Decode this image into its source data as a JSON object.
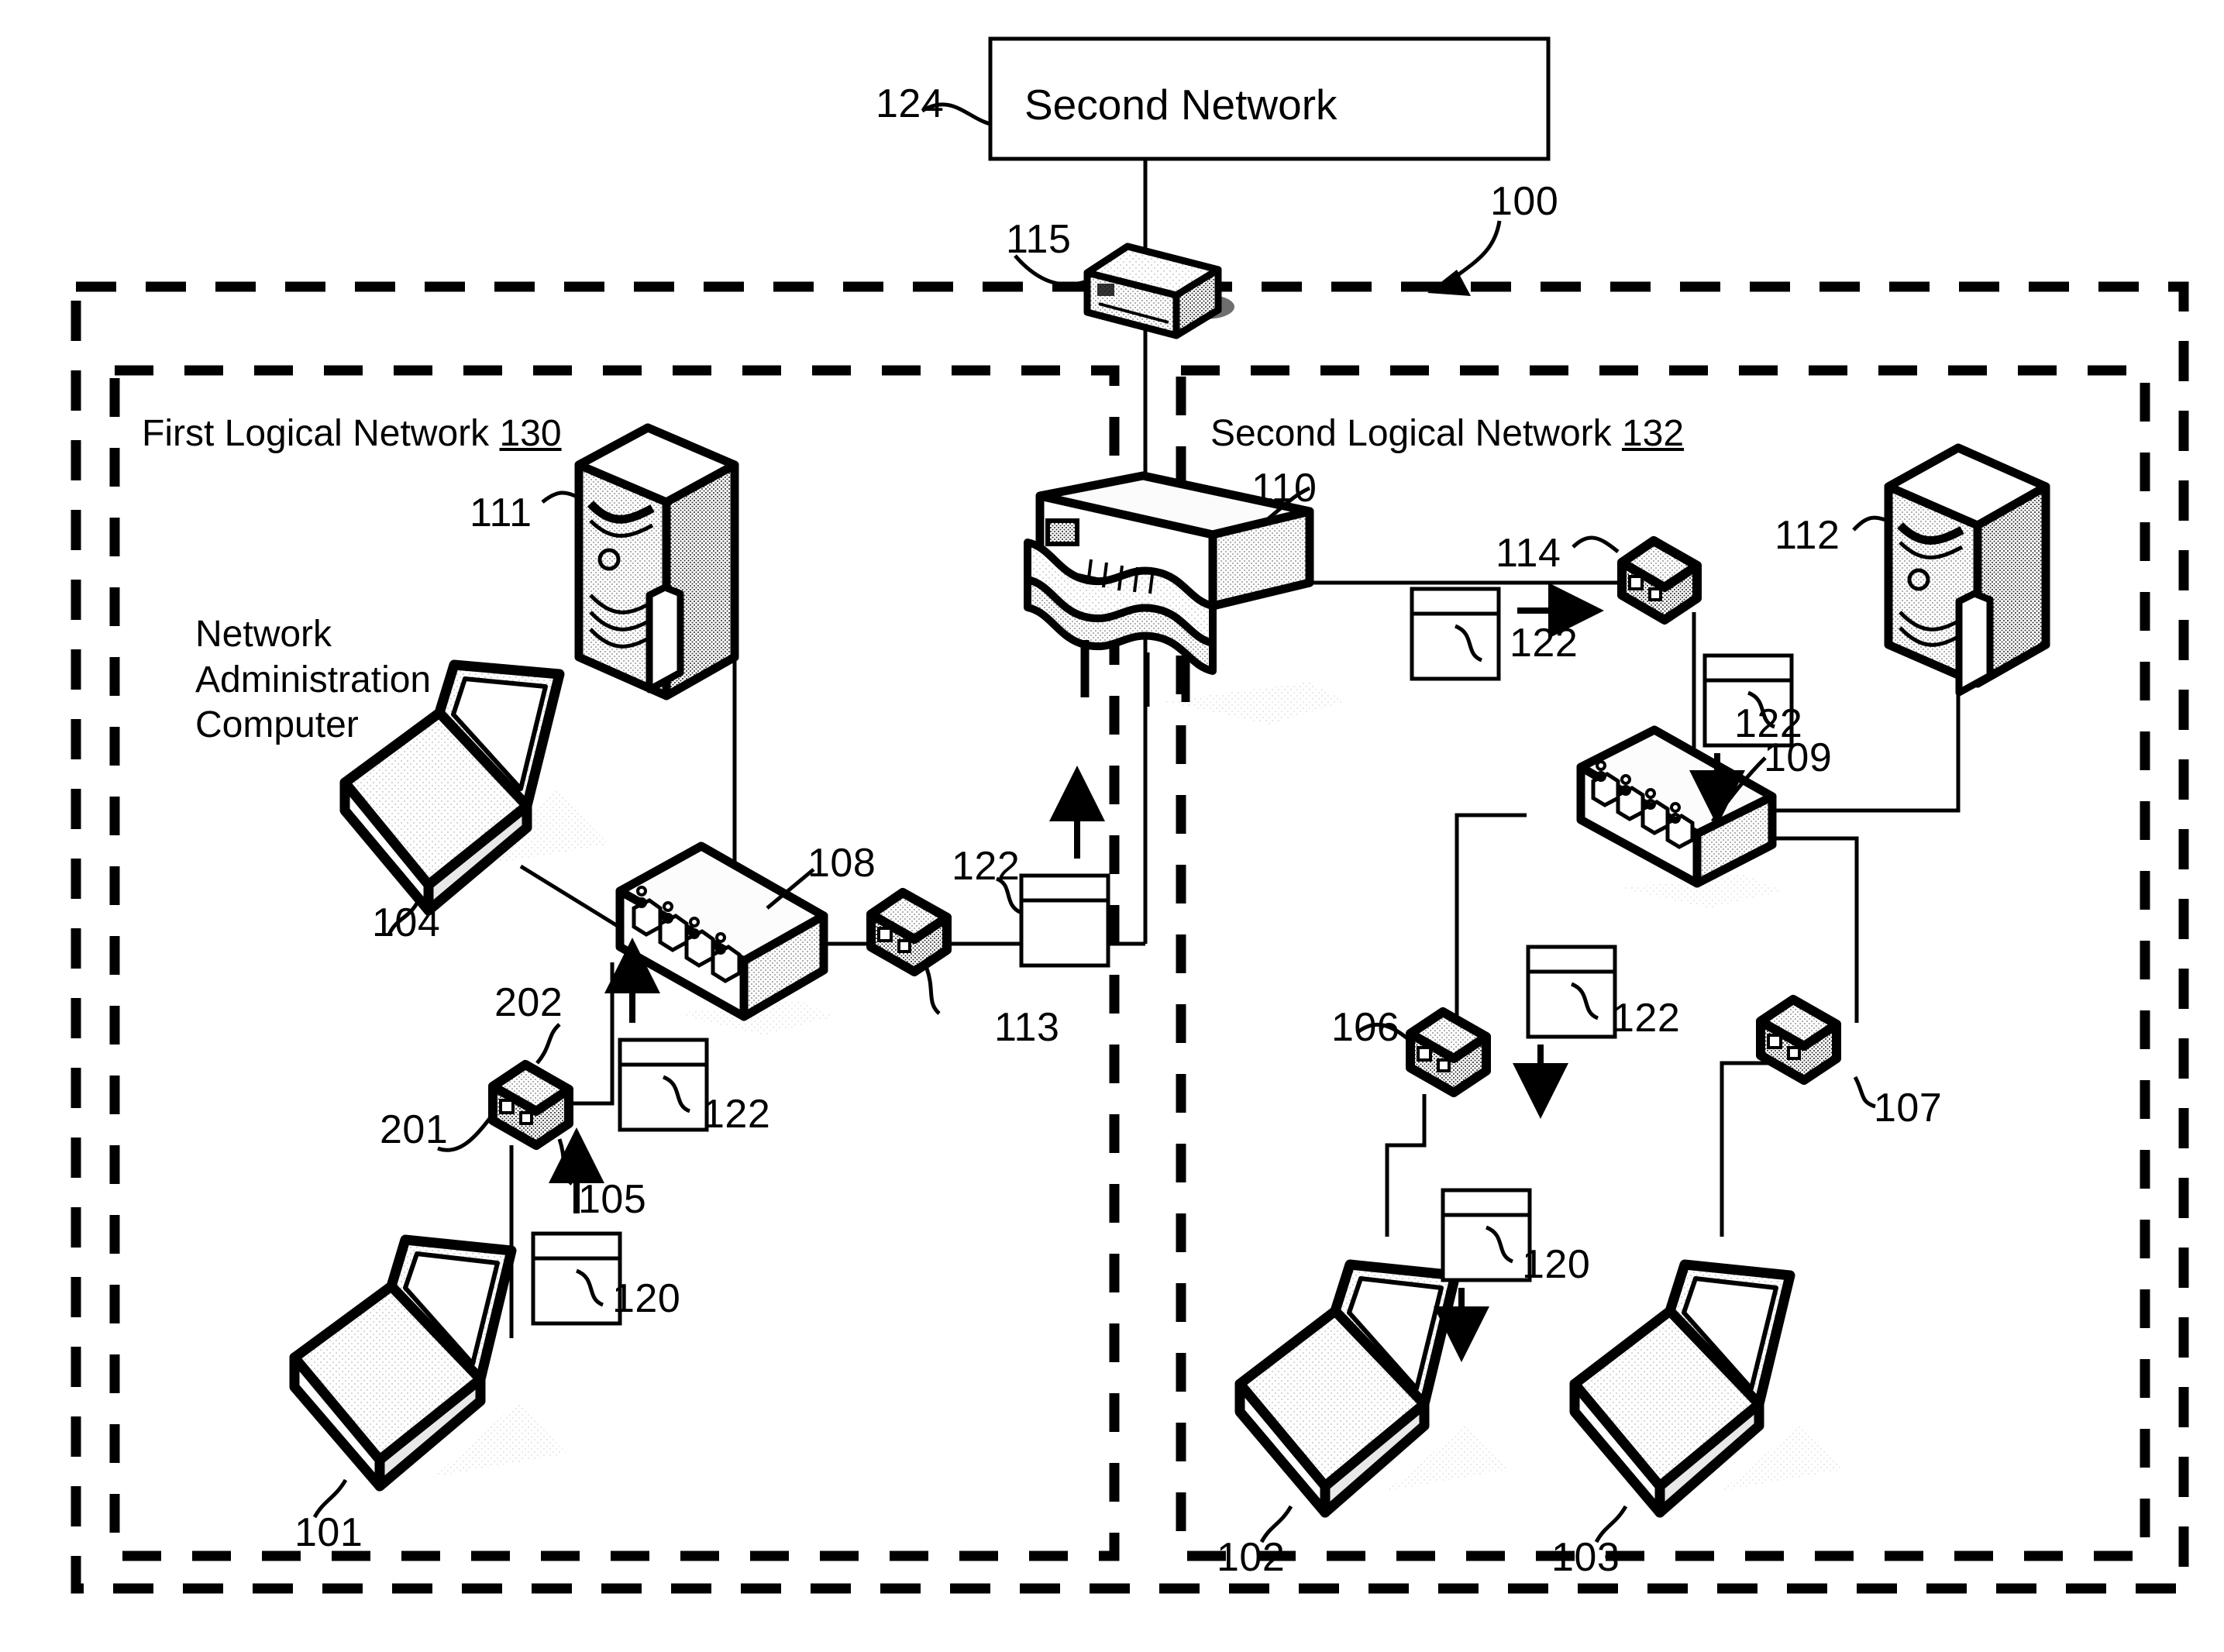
{
  "figure": {
    "title": "Network system topology diagram",
    "system_ref": "100"
  },
  "external_network": {
    "label": "Second Network",
    "ref": "124"
  },
  "logical_networks": [
    {
      "name": "First Logical Network",
      "ref": "130"
    },
    {
      "name": "Second Logical Network",
      "ref": "132"
    }
  ],
  "captions": {
    "network_admin_computer": "Network\nAdministration\nComputer"
  },
  "refs": {
    "system": "100",
    "laptop_101": "101",
    "laptop_102": "102",
    "laptop_103": "103",
    "admin_laptop_104": "104",
    "device_105": "105",
    "device_106": "106",
    "device_107": "107",
    "switch_108": "108",
    "switch_109": "109",
    "router_110": "110",
    "server_111": "111",
    "server_112": "112",
    "device_113": "113",
    "device_114": "114",
    "gateway_115": "115",
    "packet_120_left": "120",
    "packet_120_right": "120",
    "packet_122_a": "122",
    "packet_122_b": "122",
    "packet_122_c": "122",
    "packet_122_d": "122",
    "packet_122_e": "122",
    "port_201": "201",
    "port_202": "202",
    "external_network": "124",
    "first_logical_network": "130",
    "second_logical_network": "132"
  },
  "colors": {
    "ink": "#000000",
    "paper": "#ffffff",
    "fill_light": "#f2f2f2",
    "fill_shade": "#cfcfcf",
    "fill_mid": "#e2e2e2"
  },
  "chart_data": {
    "type": "diagram",
    "title": "Network topology with two logical networks",
    "nodes": [
      {
        "ref": "124",
        "type": "network-cloud-box",
        "label": "Second Network"
      },
      {
        "ref": "115",
        "type": "gateway",
        "label": ""
      },
      {
        "ref": "110",
        "type": "router",
        "label": ""
      },
      {
        "ref": "108",
        "type": "switch",
        "label": ""
      },
      {
        "ref": "109",
        "type": "switch",
        "label": ""
      },
      {
        "ref": "111",
        "type": "server",
        "label": ""
      },
      {
        "ref": "112",
        "type": "server",
        "label": ""
      },
      {
        "ref": "113",
        "type": "network-device",
        "label": ""
      },
      {
        "ref": "114",
        "type": "network-device",
        "label": ""
      },
      {
        "ref": "105",
        "type": "network-device",
        "label": ""
      },
      {
        "ref": "106",
        "type": "network-device",
        "label": ""
      },
      {
        "ref": "107",
        "type": "network-device",
        "label": ""
      },
      {
        "ref": "101",
        "type": "laptop",
        "label": ""
      },
      {
        "ref": "102",
        "type": "laptop",
        "label": ""
      },
      {
        "ref": "103",
        "type": "laptop",
        "label": ""
      },
      {
        "ref": "104",
        "type": "laptop",
        "label": "Network Administration Computer"
      }
    ],
    "groups": [
      {
        "ref": "100",
        "label": "",
        "style": "dashed-outer"
      },
      {
        "ref": "130",
        "label": "First Logical Network",
        "style": "dashed-inner"
      },
      {
        "ref": "132",
        "label": "Second Logical Network",
        "style": "dashed-inner"
      }
    ],
    "edges": [
      {
        "from": "124",
        "to": "115"
      },
      {
        "from": "115",
        "to": "110"
      },
      {
        "from": "110",
        "to": "113"
      },
      {
        "from": "113",
        "to": "108"
      },
      {
        "from": "108",
        "to": "104"
      },
      {
        "from": "108",
        "to": "111"
      },
      {
        "from": "108",
        "to": "105"
      },
      {
        "from": "105",
        "to": "101"
      },
      {
        "from": "110",
        "to": "114"
      },
      {
        "from": "114",
        "to": "109"
      },
      {
        "from": "109",
        "to": "112"
      },
      {
        "from": "109",
        "to": "106"
      },
      {
        "from": "109",
        "to": "107"
      },
      {
        "from": "106",
        "to": "102"
      },
      {
        "from": "107",
        "to": "103"
      }
    ],
    "packets": [
      {
        "ref": "120",
        "location": "between 101 and 105",
        "direction": "up"
      },
      {
        "ref": "122",
        "location": "between 105 and 108",
        "direction": "up"
      },
      {
        "ref": "122",
        "location": "between 113 and 110",
        "direction": "up"
      },
      {
        "ref": "122",
        "location": "between 110 and 114",
        "direction": "right"
      },
      {
        "ref": "122",
        "location": "between 114 and 109",
        "direction": "down"
      },
      {
        "ref": "122",
        "location": "between 109 and 106",
        "direction": "down"
      },
      {
        "ref": "120",
        "location": "between 106 and 102",
        "direction": "down"
      }
    ]
  }
}
